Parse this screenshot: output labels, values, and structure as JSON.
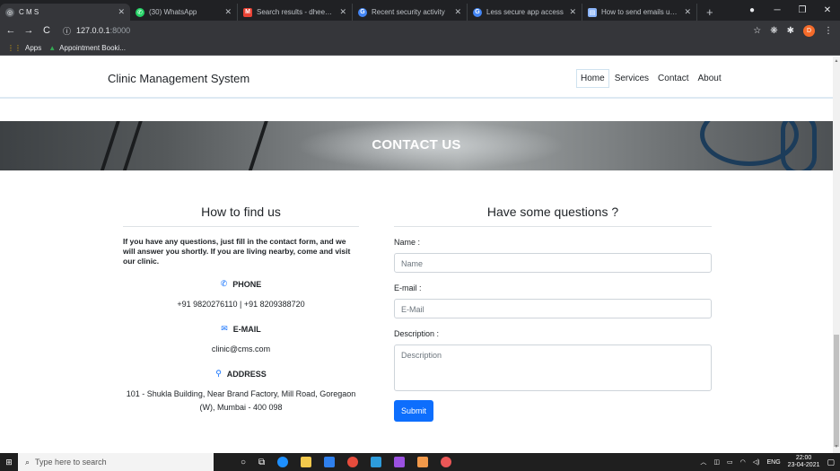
{
  "browser": {
    "tabs": [
      {
        "title": "C M S",
        "icon": "globe-icon",
        "color": "#5f6368",
        "active": true
      },
      {
        "title": "(30) WhatsApp",
        "icon": "whatsapp-icon",
        "color": "#25d366"
      },
      {
        "title": "Search results - dheerajpoo",
        "icon": "gmail-icon",
        "color": "#ea4335"
      },
      {
        "title": "Recent security activity",
        "icon": "google-icon",
        "color": "#4285f4"
      },
      {
        "title": "Less secure app access",
        "icon": "google-icon",
        "color": "#4285f4"
      },
      {
        "title": "How to send emails using P",
        "icon": "page-icon",
        "color": "#8ab4f8"
      }
    ],
    "new_tab": "+",
    "url_host": "127.0.0.1",
    "url_port": ":8000",
    "profile_initial": "D",
    "bookmarks": [
      {
        "label": "Apps",
        "icon": "apps-grid-icon"
      },
      {
        "label": "Appointment Booki...",
        "icon": "drive-icon"
      }
    ]
  },
  "site": {
    "brand": "Clinic Management System",
    "menu": [
      "Home",
      "Services",
      "Contact",
      "About"
    ],
    "active_menu": "Home",
    "banner_title": "CONTACT US"
  },
  "find": {
    "title": "How to find us",
    "intro": "If you have any questions, just fill in the contact form, and we will answer you shortly. If you are living nearby, come and visit our clinic.",
    "phone_label": "PHONE",
    "phone_value": "+91 9820276110  |  +91 8209388720",
    "email_label": "E-MAIL",
    "email_value": "clinic@cms.com",
    "address_label": "ADDRESS",
    "address_value": "101 - Shukla Building, Near Brand Factory, Mill Road, Goregaon (W), Mumbai - 400 098"
  },
  "form": {
    "title": "Have some questions ?",
    "name_label": "Name :",
    "name_placeholder": "Name",
    "email_label": "E-mail :",
    "email_placeholder": "E-Mail",
    "description_label": "Description :",
    "description_placeholder": "Description",
    "submit_label": "Submit",
    "accent": "#0d6efd"
  },
  "taskbar": {
    "search_placeholder": "Type here to search",
    "language": "ENG",
    "time": "22:00",
    "date": "23-04-2021"
  }
}
